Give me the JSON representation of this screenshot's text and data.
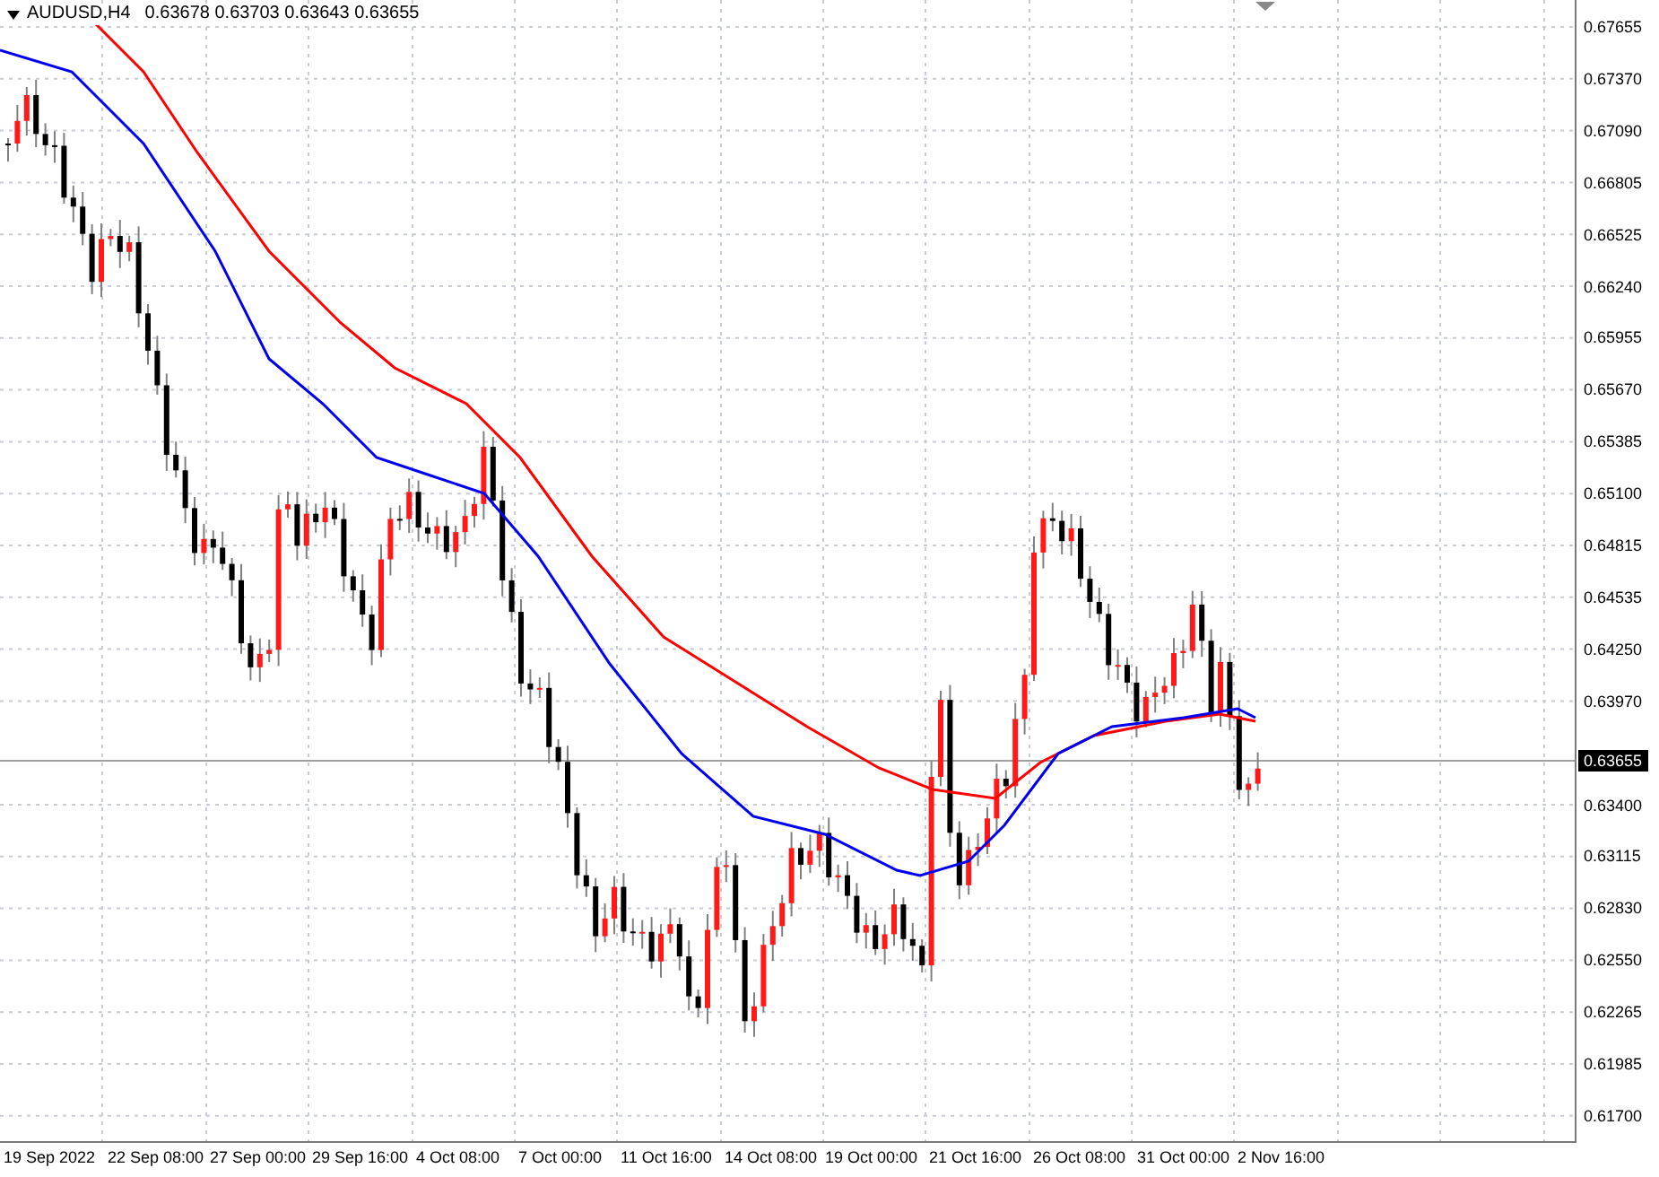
{
  "chart_header": {
    "symbol": "AUDUSD,H4",
    "quotes": "0.63678 0.63703 0.63643 0.63655"
  },
  "price_axis": {
    "labels": [
      "0.67655",
      "0.67370",
      "0.67090",
      "0.66805",
      "0.66525",
      "0.66240",
      "0.65955",
      "0.65670",
      "0.65385",
      "0.65100",
      "0.64815",
      "0.64535",
      "0.64250",
      "0.63970",
      "0.63400",
      "0.63115",
      "0.62830",
      "0.62550",
      "0.62265",
      "0.61985",
      "0.61700"
    ],
    "current_price": "0.63655"
  },
  "time_axis": {
    "labels": [
      "19 Sep 2022",
      "22 Sep 08:00",
      "27 Sep 00:00",
      "29 Sep 16:00",
      "4 Oct 08:00",
      "7 Oct 00:00",
      "11 Oct 16:00",
      "14 Oct 08:00",
      "19 Oct 00:00",
      "21 Oct 16:00",
      "26 Oct 08:00",
      "31 Oct 00:00",
      "2 Nov 16:00"
    ]
  }
}
